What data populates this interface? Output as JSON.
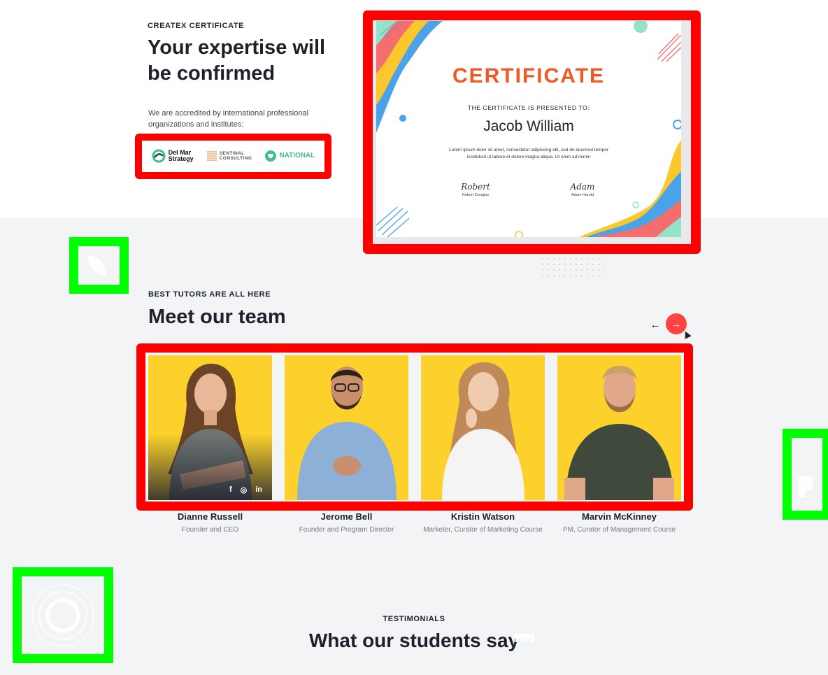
{
  "certificate_section": {
    "eyebrow": "CREATEX CERTIFICATE",
    "title": "Your expertise will be confirmed",
    "description": "We are accredited by international professional organizations and institutes:",
    "partners": [
      {
        "name_line1": "Del Mar",
        "name_line2": "Strategy",
        "icon": "delmar-logo-icon"
      },
      {
        "name_line1": "SENTINAL",
        "name_line2": "CONSULTING",
        "icon": "sentinal-logo-icon"
      },
      {
        "name_line1": "NATIONAL",
        "icon": "national-heart-icon"
      }
    ],
    "certificate": {
      "heading": "CERTIFICATE",
      "presented_to": "THE CERTIFICATE IS PRESENTED TO:",
      "recipient": "Jacob William",
      "body": "Lorem ipsum dolor sit amet, consectetur adipiscing elit, sed do eiusmod tempor incididunt ut labore et dolore magna aliqua. Ut enim ad minim",
      "signatures": [
        {
          "script": "Robert",
          "name": "Robert Douglas"
        },
        {
          "script": "Adam",
          "name": "Adam Harold"
        }
      ]
    }
  },
  "team_section": {
    "eyebrow": "BEST TUTORS ARE ALL HERE",
    "title": "Meet our team",
    "nav": {
      "prev": "←",
      "next": "→"
    },
    "members": [
      {
        "name": "Dianne Russell",
        "role": "Founder and CEO"
      },
      {
        "name": "Jerome Bell",
        "role": "Founder and Program Director"
      },
      {
        "name": "Kristin Watson",
        "role": "Marketer, Curator of Marketing Course"
      },
      {
        "name": "Marvin McKinney",
        "role": "PM, Curator of Management Course"
      }
    ],
    "social": [
      "f",
      "◎",
      "in"
    ]
  },
  "testimonials_section": {
    "eyebrow": "TESTIMONIALS",
    "title": "What our students say"
  },
  "colors": {
    "accent": "#ff4242",
    "photo_bg": "#fdd12b",
    "annotation_red": "#ff0000",
    "annotation_green": "#00ff00",
    "certificate_heading": "#ef5a24"
  }
}
